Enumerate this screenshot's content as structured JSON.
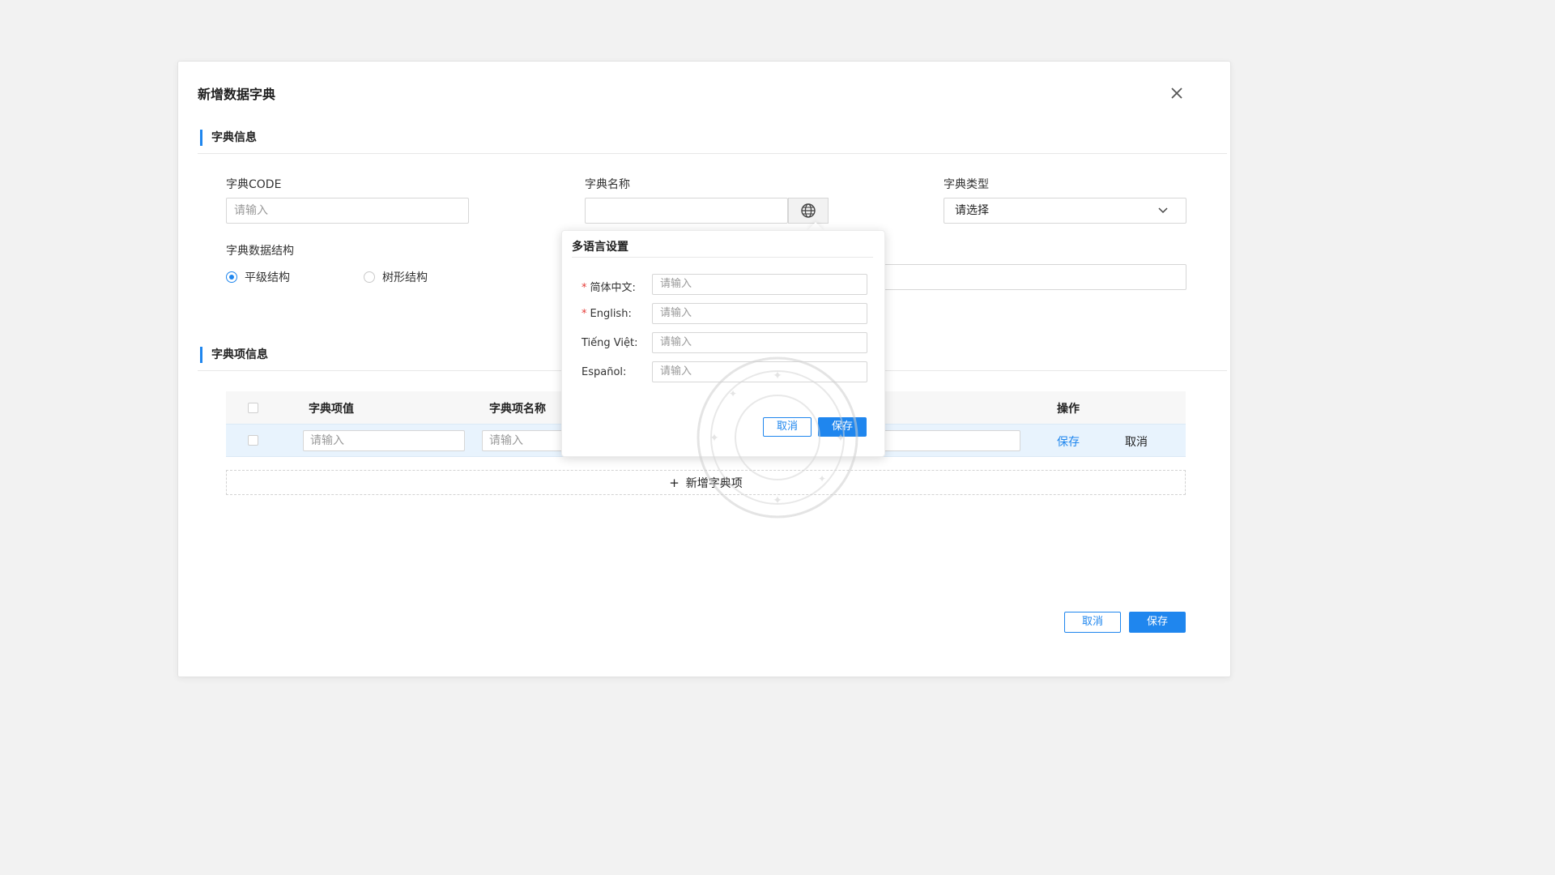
{
  "dialog": {
    "title": "新增数据字典"
  },
  "section_info": {
    "title": "字典信息",
    "code_label": "字典CODE",
    "code_placeholder": "请输入",
    "name_label": "字典名称",
    "name_value": "",
    "type_label": "字典类型",
    "type_value": "请选择",
    "structure_label": "字典数据结构",
    "structure_options": [
      "平级结构",
      "树形结构"
    ],
    "structure_selected": "平级结构"
  },
  "section_items": {
    "title": "字典项信息",
    "columns": [
      "字典项值",
      "字典项名称",
      "操作"
    ],
    "row": {
      "value_placeholder": "请输入",
      "name_placeholder": "请输入",
      "save_action": "保存",
      "cancel_action": "取消"
    },
    "add_label": "新增字典项"
  },
  "footer": {
    "cancel_label": "取消",
    "save_label": "保存"
  },
  "popover": {
    "title": "多语言设置",
    "fields": [
      {
        "label": "简体中文:",
        "required": true,
        "placeholder": "请输入"
      },
      {
        "label": "English:",
        "required": true,
        "placeholder": "请输入"
      },
      {
        "label": "Tiếng Việt:",
        "required": false,
        "placeholder": "请输入"
      },
      {
        "label": "Español:",
        "required": false,
        "placeholder": "请输入"
      }
    ],
    "cancel_label": "取消",
    "save_label": "保存"
  },
  "colors": {
    "accent": "#1f86ee",
    "row_highlight": "#e8f3fd",
    "required": "#e53935"
  }
}
